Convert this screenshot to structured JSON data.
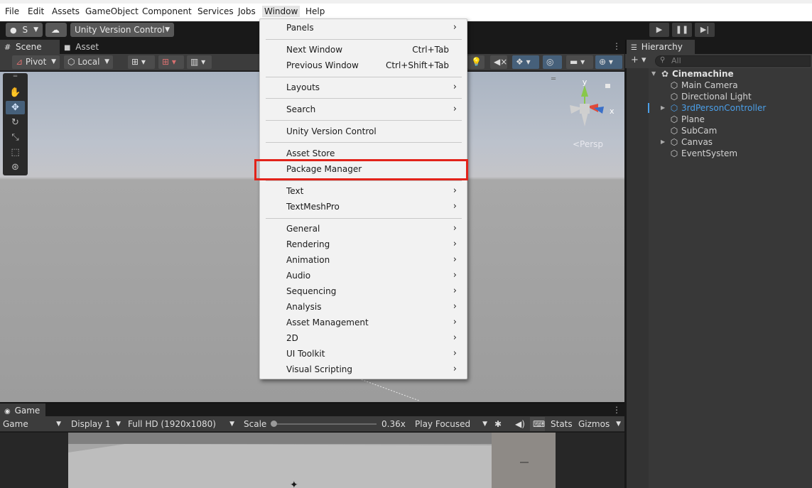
{
  "menubar": {
    "items": [
      "File",
      "Edit",
      "Assets",
      "GameObject",
      "Component",
      "Services",
      "Jobs",
      "Window",
      "Help"
    ],
    "active": "Window"
  },
  "toolbar": {
    "account_label": "S",
    "version_control_label": "Unity Version Control",
    "play_icon": "play-icon",
    "pause_icon": "pause-icon",
    "step_icon": "step-icon"
  },
  "scene": {
    "tabs": [
      "Scene",
      "Asset Store"
    ],
    "pivot_label": "Pivot",
    "local_label": "Local",
    "persp_label": "<Persp",
    "gizmo_axes": {
      "y": "y",
      "x": "x"
    }
  },
  "game": {
    "tab_label": "Game",
    "view_select": "Game",
    "display_select": "Display 1",
    "resolution_select": "Full HD (1920x1080)",
    "scale_label": "Scale",
    "scale_value": "0.36x",
    "scale_fraction": 0.0,
    "play_mode_select": "Play Focused",
    "stats_label": "Stats",
    "gizmos_label": "Gizmos"
  },
  "hierarchy": {
    "tab_label": "Hierarchy",
    "search_placeholder": "All",
    "root": "Cinemachine",
    "items": [
      {
        "label": "Main Camera",
        "highlighted": false,
        "foldable": false
      },
      {
        "label": "Directional Light",
        "highlighted": false,
        "foldable": false
      },
      {
        "label": "3rdPersonController",
        "highlighted": true,
        "foldable": true
      },
      {
        "label": "Plane",
        "highlighted": false,
        "foldable": false
      },
      {
        "label": "SubCam",
        "highlighted": false,
        "foldable": false
      },
      {
        "label": "Canvas",
        "highlighted": false,
        "foldable": true
      },
      {
        "label": "EventSystem",
        "highlighted": false,
        "foldable": false
      }
    ],
    "highlight_color": "#4b9fe8"
  },
  "window_menu": {
    "items": [
      {
        "label": "Panels",
        "shortcut": "",
        "submenu": true
      },
      {
        "label": "Next Window",
        "shortcut": "Ctrl+Tab",
        "submenu": false
      },
      {
        "label": "Previous Window",
        "shortcut": "Ctrl+Shift+Tab",
        "submenu": false
      },
      {
        "label": "Layouts",
        "shortcut": "",
        "submenu": true
      },
      {
        "label": "Search",
        "shortcut": "",
        "submenu": true
      },
      {
        "label": "Unity Version Control",
        "shortcut": "",
        "submenu": false
      },
      {
        "label": "Asset Store",
        "shortcut": "",
        "submenu": false
      },
      {
        "label": "Package Manager",
        "shortcut": "",
        "submenu": false
      },
      {
        "label": "Text",
        "shortcut": "",
        "submenu": true
      },
      {
        "label": "TextMeshPro",
        "shortcut": "",
        "submenu": true
      },
      {
        "label": "General",
        "shortcut": "",
        "submenu": true
      },
      {
        "label": "Rendering",
        "shortcut": "",
        "submenu": true
      },
      {
        "label": "Animation",
        "shortcut": "",
        "submenu": true
      },
      {
        "label": "Audio",
        "shortcut": "",
        "submenu": true
      },
      {
        "label": "Sequencing",
        "shortcut": "",
        "submenu": true
      },
      {
        "label": "Analysis",
        "shortcut": "",
        "submenu": true
      },
      {
        "label": "Asset Management",
        "shortcut": "",
        "submenu": true
      },
      {
        "label": "2D",
        "shortcut": "",
        "submenu": true
      },
      {
        "label": "UI Toolkit",
        "shortcut": "",
        "submenu": true
      },
      {
        "label": "Visual Scripting",
        "shortcut": "",
        "submenu": true
      }
    ],
    "highlighted_item": "Package Manager",
    "highlight_color": "#e2231a"
  }
}
